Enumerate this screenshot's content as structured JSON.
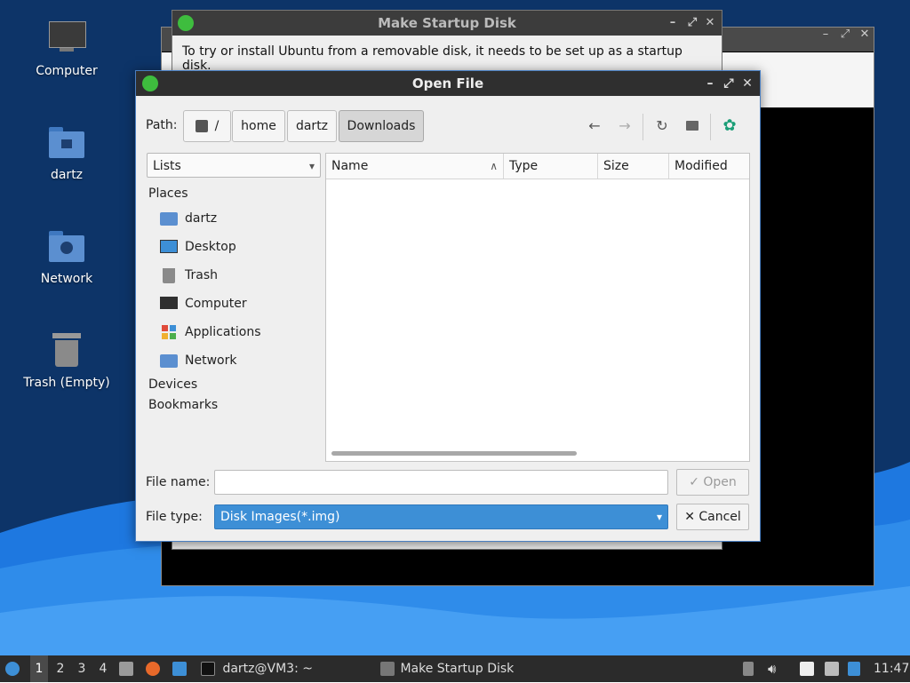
{
  "colors": {
    "accent": "#3d8fd6",
    "desktop_bg": "#0d3468",
    "wave": "#1e78e0",
    "folder": "#5b8fd0"
  },
  "desktop": {
    "icons": [
      {
        "label": "Computer",
        "icon": "computer-icon"
      },
      {
        "label": "dartz",
        "icon": "home-folder-icon"
      },
      {
        "label": "Network",
        "icon": "network-folder-icon"
      },
      {
        "label": "Trash (Empty)",
        "icon": "trash-icon"
      }
    ]
  },
  "background_window": {
    "title": "Make Startup Disk",
    "message": "To try or install Ubuntu from a removable disk, it needs to be set up as a startup disk."
  },
  "dialog": {
    "title": "Open File",
    "path_label": "Path:",
    "breadcrumb": [
      "/",
      "home",
      "dartz",
      "Downloads"
    ],
    "places_combo": "Lists",
    "sidebar": {
      "places_header": "Places",
      "items": [
        {
          "label": "dartz",
          "icon": "home-folder-icon"
        },
        {
          "label": "Desktop",
          "icon": "desktop-icon"
        },
        {
          "label": "Trash",
          "icon": "trash-icon"
        },
        {
          "label": "Computer",
          "icon": "computer-icon"
        },
        {
          "label": "Applications",
          "icon": "applications-icon"
        },
        {
          "label": "Network",
          "icon": "network-folder-icon"
        }
      ],
      "devices_header": "Devices",
      "bookmarks_header": "Bookmarks"
    },
    "columns": [
      "Name",
      "Type",
      "Size",
      "Modified"
    ],
    "file_name_label": "File name:",
    "file_name_value": "",
    "file_type_label": "File type:",
    "file_type_value": "Disk Images(*.img)",
    "open_label": "Open",
    "cancel_label": "Cancel"
  },
  "taskbar": {
    "workspaces": [
      "1",
      "2",
      "3",
      "4"
    ],
    "terminal_label": "dartz@VM3: ~",
    "task_label": "Make Startup Disk",
    "clock": "11:47"
  }
}
